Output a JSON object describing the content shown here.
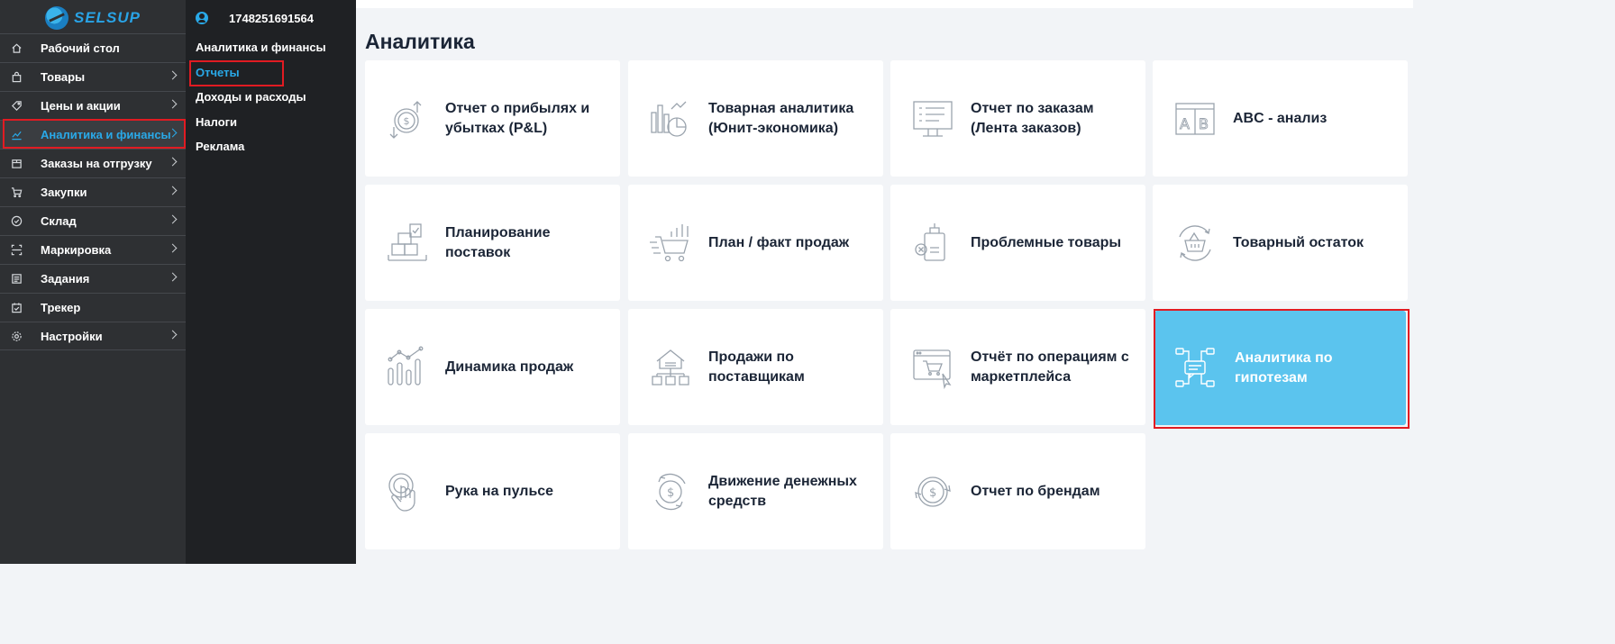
{
  "brand": {
    "name": "SELSUP"
  },
  "sidebar": {
    "items": [
      {
        "label": "Рабочий стол",
        "icon": "home-icon"
      },
      {
        "label": "Товары",
        "icon": "bag-icon"
      },
      {
        "label": "Цены и акции",
        "icon": "tag-icon"
      },
      {
        "label": "Аналитика и финансы",
        "icon": "chart-line-icon",
        "active": true
      },
      {
        "label": "Заказы на отгрузку",
        "icon": "box-icon"
      },
      {
        "label": "Закупки",
        "icon": "cart-icon"
      },
      {
        "label": "Склад",
        "icon": "check-circle-icon"
      },
      {
        "label": "Маркировка",
        "icon": "barcode-scan-icon"
      },
      {
        "label": "Задания",
        "icon": "task-icon"
      },
      {
        "label": "Трекер",
        "icon": "calendar-check-icon"
      },
      {
        "label": "Настройки",
        "icon": "gear-icon"
      }
    ]
  },
  "submenu": {
    "user_id": "1748251691564",
    "items": [
      {
        "label": "Аналитика и финансы"
      },
      {
        "label": "Отчеты",
        "active": true
      },
      {
        "label": "Доходы и расходы"
      },
      {
        "label": "Налоги"
      },
      {
        "label": "Реклама"
      }
    ]
  },
  "main": {
    "title": "Аналитика",
    "cards": [
      {
        "label": "Отчет о прибылях и убытках (P&L)",
        "icon": "profit-loss-icon"
      },
      {
        "label": "Товарная аналитика (Юнит-экономика)",
        "icon": "product-analytics-icon"
      },
      {
        "label": "Отчет по заказам (Лента заказов)",
        "icon": "orders-monitor-icon"
      },
      {
        "label": "ABC - анализ",
        "icon": "abc-icon"
      },
      {
        "label": "Планирование поставок",
        "icon": "supply-planning-icon"
      },
      {
        "label": "План / факт продаж",
        "icon": "cart-chart-icon"
      },
      {
        "label": "Проблемные товары",
        "icon": "problem-goods-icon"
      },
      {
        "label": "Товарный остаток",
        "icon": "stock-basket-icon"
      },
      {
        "label": "Динамика продаж",
        "icon": "sales-dynamics-icon"
      },
      {
        "label": "Продажи по поставщикам",
        "icon": "suppliers-icon"
      },
      {
        "label": "Отчёт по операциям с маркетплейса",
        "icon": "marketplace-ops-icon"
      },
      {
        "label": "Аналитика по гипотезам",
        "icon": "hypothesis-icon",
        "highlighted": true
      },
      {
        "label": "Рука на пульсе",
        "icon": "hand-pulse-icon"
      },
      {
        "label": "Движение денежных средств",
        "icon": "cash-flow-icon"
      },
      {
        "label": "Отчет по брендам",
        "icon": "brands-coin-icon"
      }
    ]
  },
  "colors": {
    "accent": "#29a9e8",
    "highlight_card": "#5bc4ee",
    "annotation_red": "#e11b22",
    "sidebar_bg": "#2e3033",
    "submenu_bg": "#1f2124"
  }
}
